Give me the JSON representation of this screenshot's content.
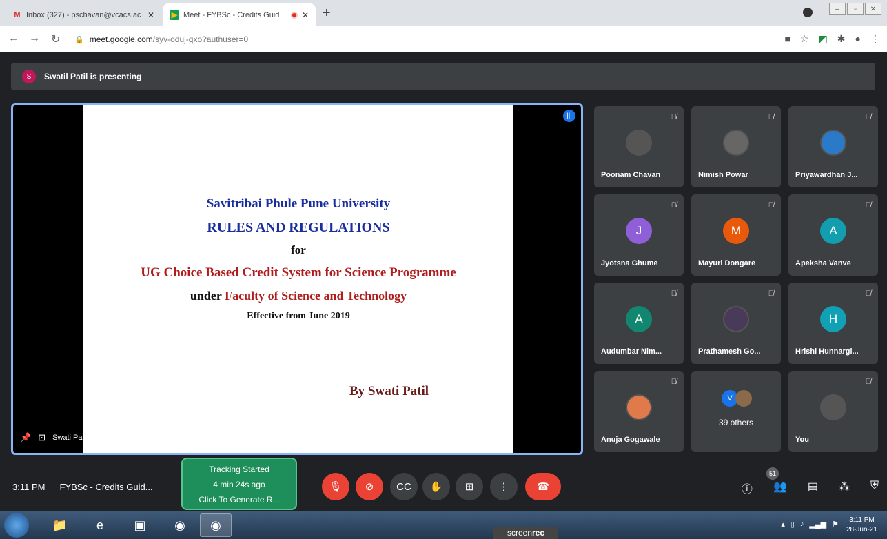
{
  "browser": {
    "tabs": [
      {
        "title": "Inbox (327) - pschavan@vcacs.ac",
        "favicon": "gmail-icon"
      },
      {
        "title": "Meet - FYBSc - Credits Guid",
        "favicon": "meet-icon"
      }
    ],
    "new_tab": "+",
    "url_domain": "meet.google.com",
    "url_path": "/syv-oduj-qxo?authuser=0"
  },
  "meet": {
    "presenting_initial": "S",
    "presenting_text": "Swatil Patil is presenting",
    "presenter_footer": "Swati Patil",
    "slide": {
      "line1": "Savitribai Phule Pune University",
      "line2": "RULES AND REGULATIONS",
      "line3": "for",
      "line4": "UG Choice Based Credit System for Science Programme",
      "line5_a": "under",
      "line5_b": "Faculty of Science and Technology",
      "line6": "Effective from June 2019",
      "line7": "By Swati Patil"
    },
    "participants": [
      {
        "name": "Poonam Chavan",
        "initial": "",
        "color": "#555555"
      },
      {
        "name": "Nimish Powar",
        "initial": "",
        "color": "#666666"
      },
      {
        "name": "Priyawardhan J...",
        "initial": "",
        "color": "#2a7ac7"
      },
      {
        "name": "Jyotsna Ghume",
        "initial": "J",
        "color": "#8e5fd6"
      },
      {
        "name": "Mayuri Dongare",
        "initial": "M",
        "color": "#e8590c"
      },
      {
        "name": "Apeksha Vanve",
        "initial": "A",
        "color": "#129eaf"
      },
      {
        "name": "Audumbar Nim...",
        "initial": "A",
        "color": "#12876f"
      },
      {
        "name": "Prathamesh Go...",
        "initial": "",
        "color": "#4a3a5a"
      },
      {
        "name": "Hrishi Hunnargi...",
        "initial": "H",
        "color": "#12a0b5"
      },
      {
        "name": "Anuja Gogawale",
        "initial": "",
        "color": "#e07a4a"
      },
      {
        "name": "You",
        "initial": "",
        "color": "#555555"
      }
    ],
    "others": {
      "label": "39 others",
      "initial": "V"
    },
    "controls": {
      "time": "3:11 PM",
      "meeting_title": "FYBSc - Credits Guid...",
      "people_count": "51"
    },
    "tracking": {
      "line1": "Tracking Started",
      "line2": "4 min 24s ago",
      "line3": "Click To Generate R..."
    }
  },
  "taskbar": {
    "screenrec_a": "screen",
    "screenrec_b": "rec",
    "time": "3:11 PM",
    "date": "28-Jun-21"
  }
}
